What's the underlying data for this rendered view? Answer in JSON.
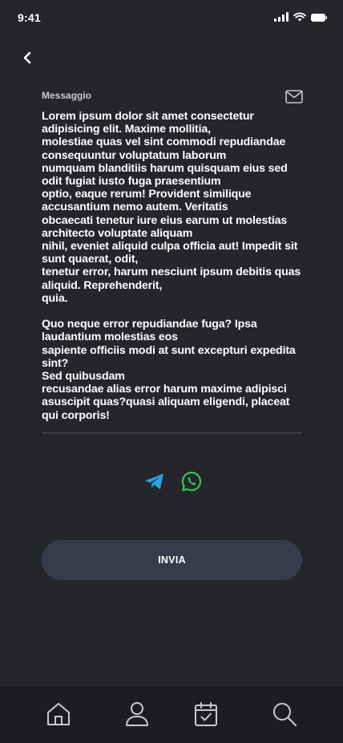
{
  "status_bar": {
    "time": "9:41"
  },
  "form": {
    "label": "Messaggio",
    "message": "Lorem ipsum dolor sit amet consectetur adipisicing elit. Maxime mollitia,\nmolestiae quas vel sint commodi repudiandae consequuntur voluptatum laborum\nnumquam blanditiis harum quisquam eius sed odit fugiat iusto fuga praesentium\noptio, eaque rerum! Provident similique accusantium nemo autem. Veritatis\nobcaecati tenetur iure eius earum ut molestias architecto voluptate aliquam\nnihil, eveniet aliquid culpa officia aut! Impedit sit sunt quaerat, odit,\ntenetur error, harum nesciunt ipsum debitis quas aliquid. Reprehenderit,\nquia.\n\nQuo neque error repudiandae fuga? Ipsa laudantium molestias eos\nsapiente officiis modi at sunt excepturi expedita sint?\nSed quibusdam\nrecusandae alias error harum maxime adipisci asuscipit quas?quasi aliquam eligendi, placeat qui corporis!",
    "send_label": "INVIA"
  },
  "share": {
    "telegram_icon": "telegram-icon",
    "whatsapp_icon": "whatsapp-icon",
    "telegram_color": "#2aa3e0",
    "whatsapp_color": "#3fbf5a"
  },
  "icons": {
    "back": "chevron-left-icon",
    "mail": "envelope-icon"
  },
  "tab_bar": {
    "items": [
      {
        "icon": "home-icon"
      },
      {
        "icon": "user-icon"
      },
      {
        "icon": "calendar-check-icon"
      },
      {
        "icon": "search-icon"
      }
    ]
  },
  "colors": {
    "background": "#24262c",
    "button": "#383c4a",
    "tab_bar": "#1b1d21",
    "icon": "#c8c9cc"
  }
}
